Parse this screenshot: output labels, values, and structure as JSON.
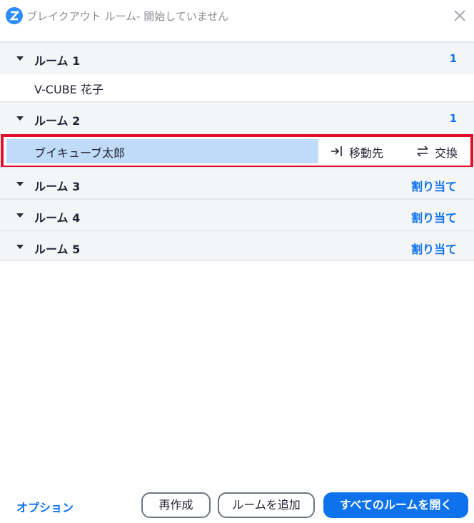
{
  "window": {
    "title": "ブレイクアウト ルーム- 開始していません"
  },
  "colors": {
    "accent": "#0e72ed",
    "selection": "#c0dbf7",
    "highlight_frame": "#e0102a",
    "room_header_bg": "#f4f5f7"
  },
  "rooms": [
    {
      "name": "ルーム 1",
      "count": "1",
      "participants": [
        "V-CUBE 花子"
      ]
    },
    {
      "name": "ルーム 2",
      "count": "1",
      "participants": [
        "ブイキューブ太郎"
      ]
    },
    {
      "name": "ルーム 3",
      "assign_label": "割り当て"
    },
    {
      "name": "ルーム 4",
      "assign_label": "割り当て"
    },
    {
      "name": "ルーム 5",
      "assign_label": "割り当て"
    }
  ],
  "selected_participant": {
    "move_label": "移動先",
    "swap_label": "交換",
    "move_icon": "move-to-icon",
    "swap_icon": "exchange-icon"
  },
  "footer": {
    "options_label": "オプション",
    "recreate_label": "再作成",
    "add_room_label": "ルームを追加",
    "open_all_label": "すべてのルームを開く"
  }
}
